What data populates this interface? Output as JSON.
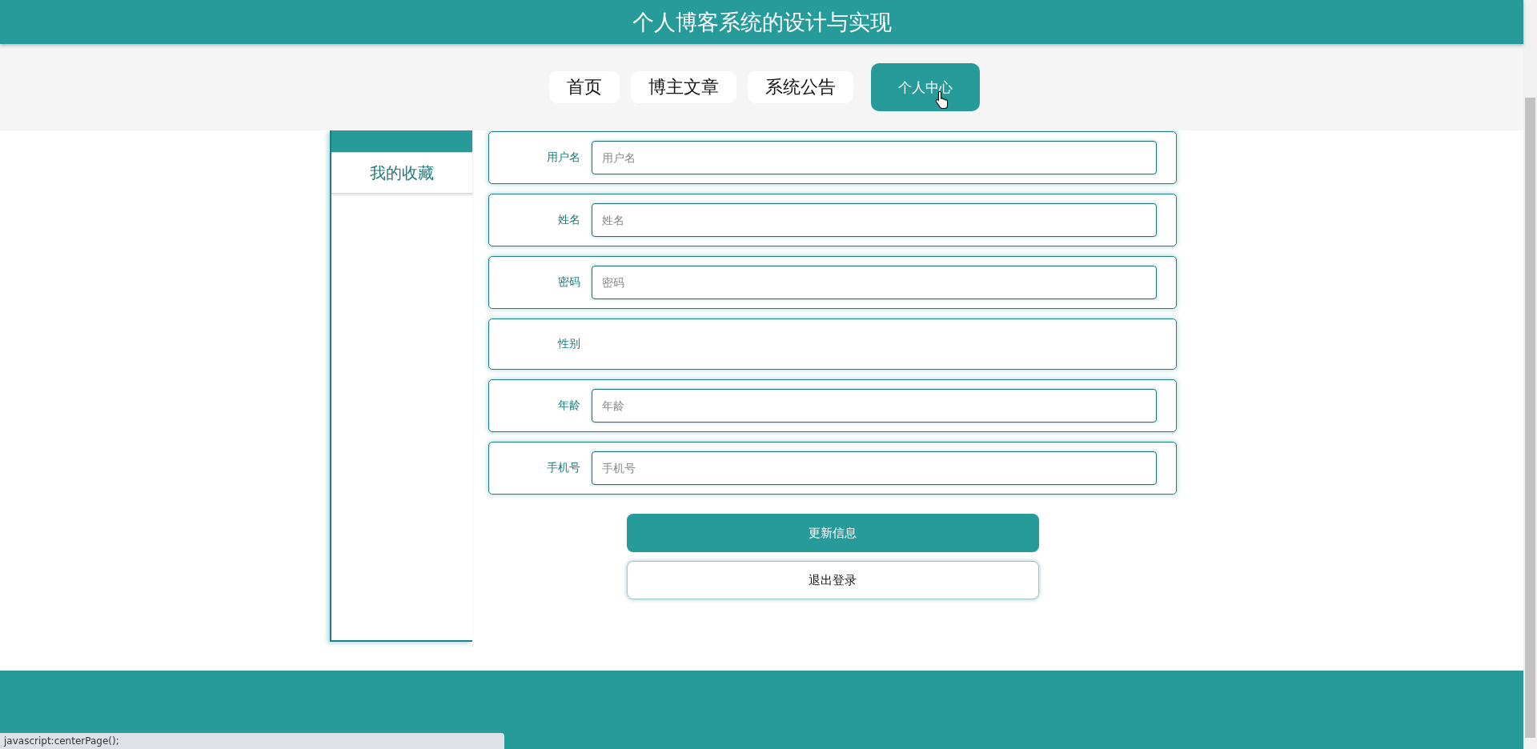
{
  "header": {
    "title": "个人博客系统的设计与实现"
  },
  "nav": {
    "tabs": [
      {
        "label": "首页",
        "selected": false
      },
      {
        "label": "博主文章",
        "selected": false
      },
      {
        "label": "系统公告",
        "selected": false
      },
      {
        "label": "个人中心",
        "selected": true
      }
    ]
  },
  "sidebar": {
    "items": [
      {
        "selected": true
      },
      {
        "label": "我的收藏",
        "selected": false
      }
    ]
  },
  "form": {
    "rows": [
      {
        "kind": "input",
        "label": "用户名",
        "placeholder": "用户名"
      },
      {
        "kind": "input",
        "label": "姓名",
        "placeholder": "姓名"
      },
      {
        "kind": "input",
        "label": "密码",
        "placeholder": "密码"
      },
      {
        "kind": "blank",
        "label": "性别"
      },
      {
        "kind": "input",
        "label": "年龄",
        "placeholder": "年龄"
      },
      {
        "kind": "input",
        "label": "手机号",
        "placeholder": "手机号"
      }
    ],
    "buttons": [
      {
        "kind": "primary",
        "label": "更新信息"
      },
      {
        "kind": "secondary",
        "label": "退出登录"
      }
    ]
  },
  "status_bar": {
    "text": "javascript:centerPage();"
  }
}
